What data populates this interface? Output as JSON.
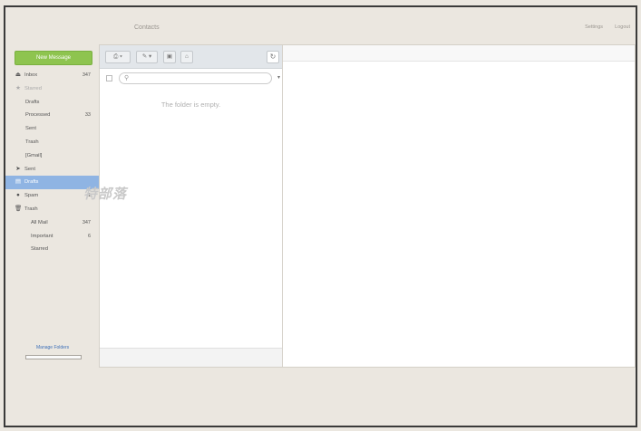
{
  "header": {
    "contacts_label": "Contacts",
    "settings_label": "Settings",
    "logout_label": "Logout"
  },
  "new_message_label": "New Message",
  "folders": [
    {
      "name": "inbox",
      "icon": "inbox-icon",
      "glyph": "⏏",
      "label": "Inbox",
      "count": "347",
      "level": 0
    },
    {
      "name": "starred",
      "icon": "star-icon",
      "glyph": "★",
      "label": "Starred",
      "count": "",
      "level": 0,
      "muted": true
    },
    {
      "name": "drafts-sub",
      "label": "Drafts",
      "count": "",
      "level": 1
    },
    {
      "name": "processed",
      "label": "Processed",
      "count": "33",
      "level": 1
    },
    {
      "name": "sent-sub",
      "label": "Sent",
      "count": "",
      "level": 1
    },
    {
      "name": "trash-sub",
      "label": "Trash",
      "count": "",
      "level": 1
    },
    {
      "name": "gmail",
      "label": "[Gmail]",
      "count": "",
      "level": 1
    },
    {
      "name": "sent",
      "icon": "paper-plane-icon",
      "glyph": "➤",
      "label": "Sent",
      "count": "",
      "level": 0
    },
    {
      "name": "drafts",
      "icon": "document-icon",
      "glyph": "▤",
      "label": "Drafts",
      "count": "",
      "level": 0,
      "active": true
    },
    {
      "name": "spam",
      "icon": "warning-icon",
      "glyph": "●",
      "label": "Spam",
      "count": "1",
      "level": 0
    },
    {
      "name": "trash",
      "icon": "trash-icon",
      "glyph": "🗑",
      "label": "Trash",
      "count": "",
      "level": 0
    },
    {
      "name": "all-mail",
      "label": "All Mail",
      "count": "347",
      "level": 2
    },
    {
      "name": "important",
      "label": "Important",
      "count": "6",
      "level": 2
    },
    {
      "name": "starred-sub",
      "label": "Starred",
      "count": "",
      "level": 2
    }
  ],
  "manage_folders_label": "Manage Folders",
  "toolbar": {
    "reply_icon": "reply-icon",
    "forward_icon": "forward-icon",
    "delete_icon": "trash-icon",
    "archive_icon": "archive-icon",
    "refresh_icon": "refresh-icon"
  },
  "search": {
    "placeholder": ""
  },
  "empty_message": "The folder is empty.",
  "watermark": "特部落"
}
